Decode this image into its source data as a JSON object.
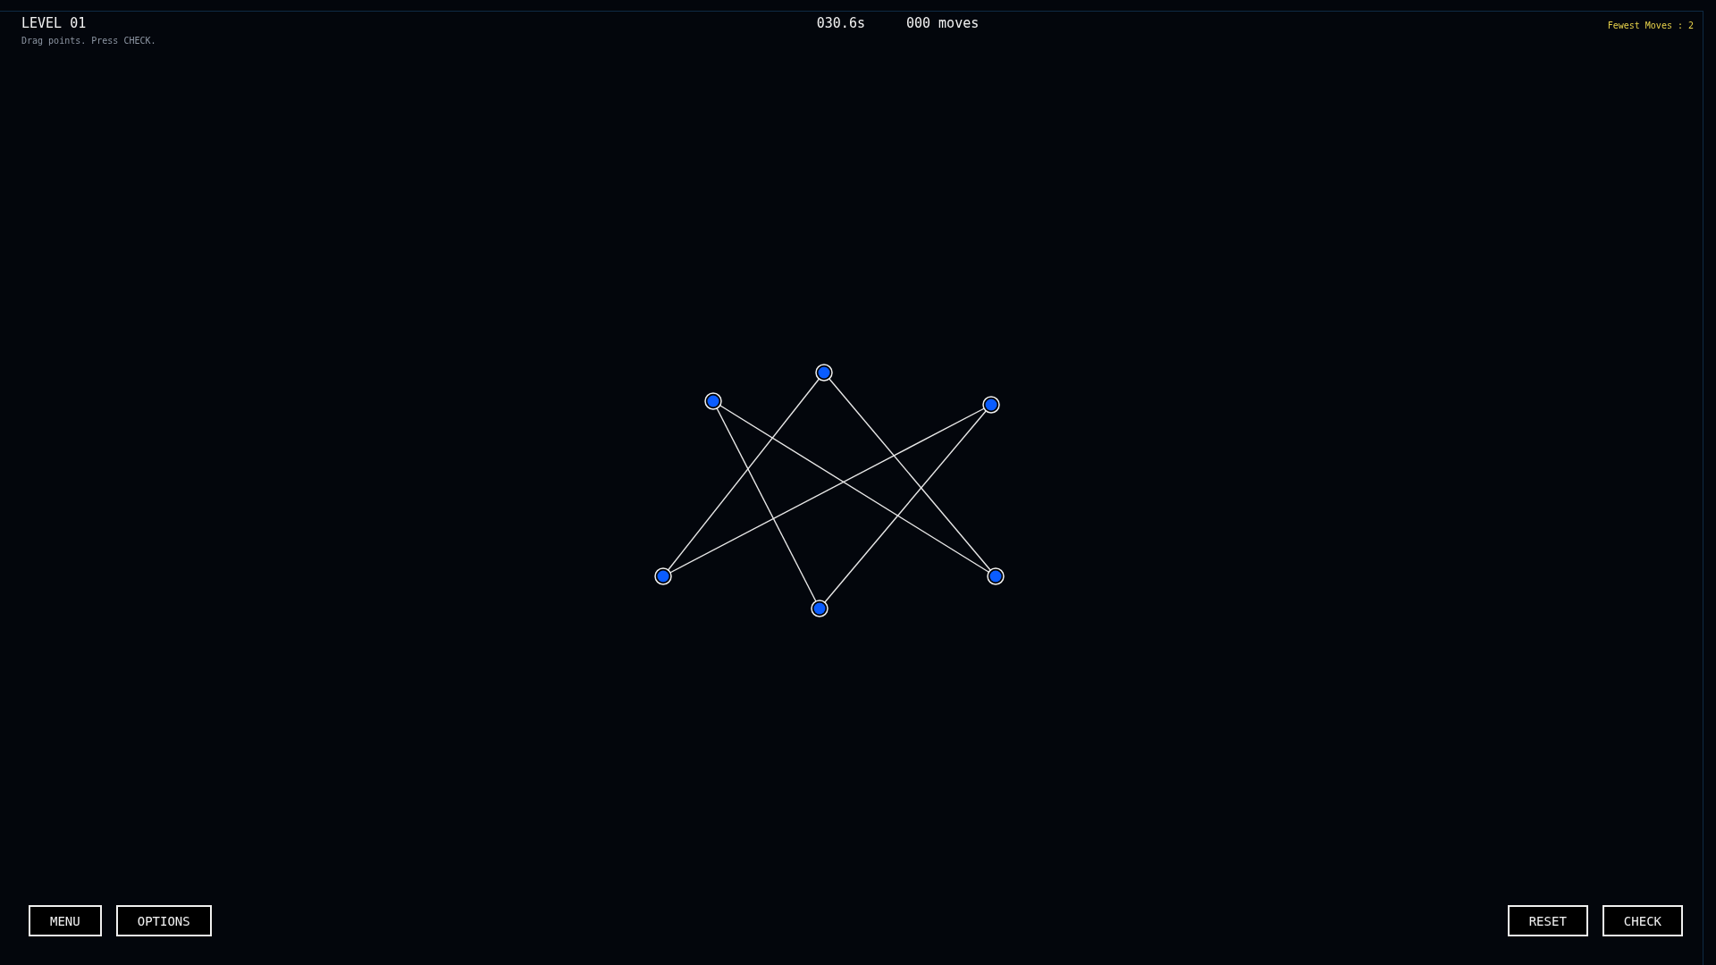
{
  "level": {
    "title": "LEVEL 01",
    "hint": "Drag points. Press CHECK."
  },
  "stats": {
    "time": "030.6s",
    "moves": "000 moves"
  },
  "best": "Fewest Moves : 2",
  "left_buttons": [
    "MENU",
    "OPTIONS"
  ],
  "right_buttons": [
    "RESET",
    "CHECK"
  ]
}
